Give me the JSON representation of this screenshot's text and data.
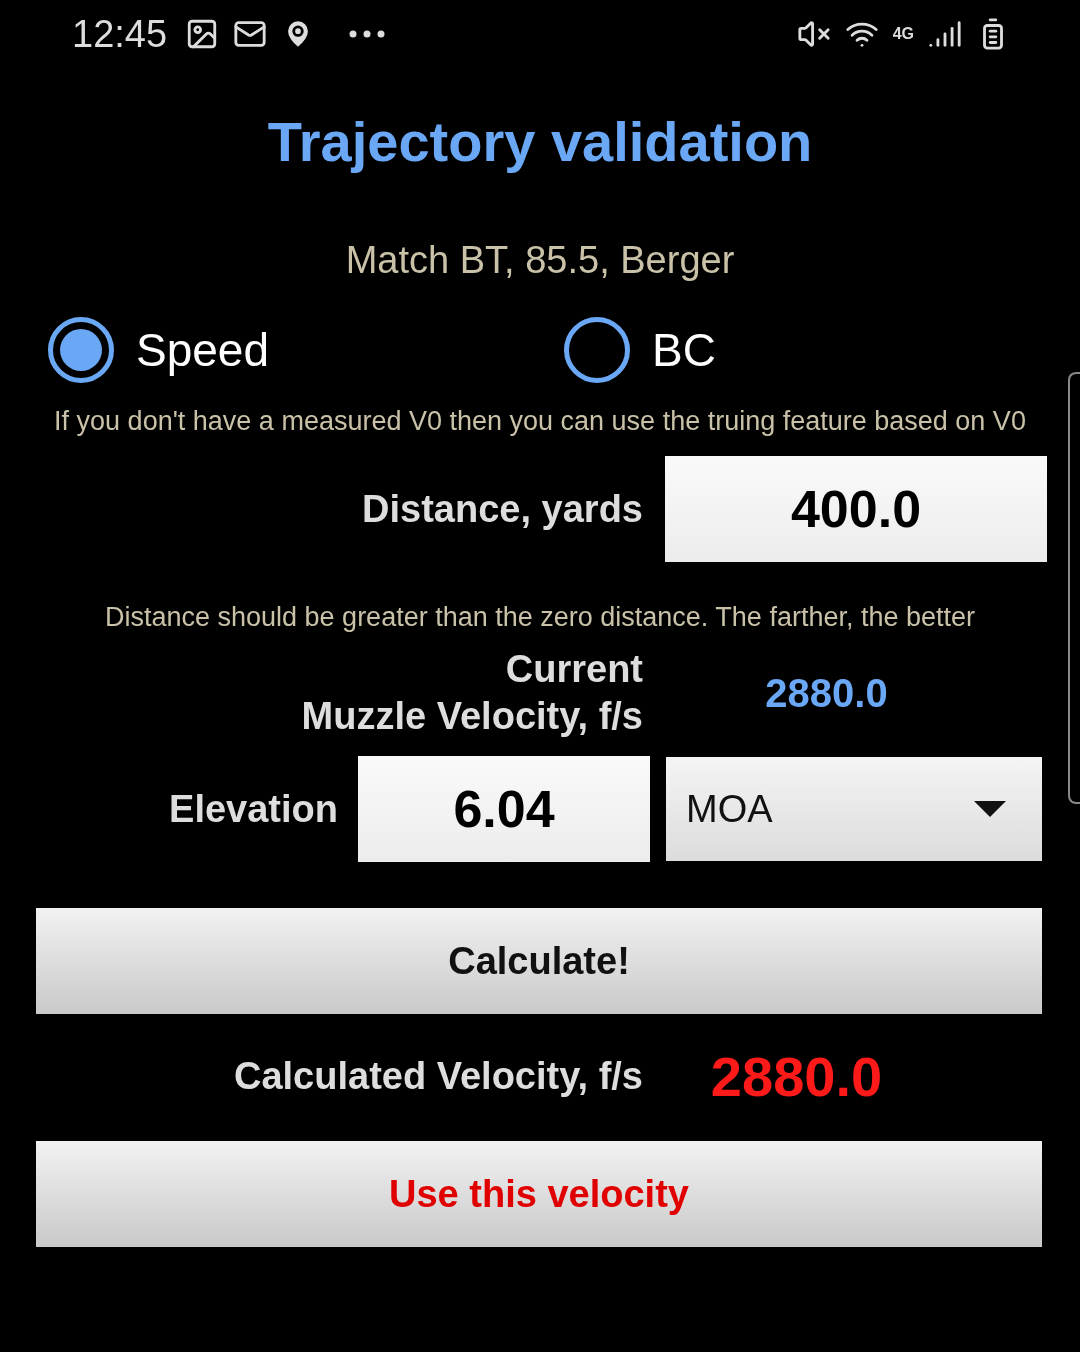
{
  "status_bar": {
    "time": "12:45",
    "network": "4G"
  },
  "title": "Trajectory validation",
  "subtitle": "Match BT, 85.5, Berger",
  "modes": [
    {
      "label": "Speed",
      "selected": true
    },
    {
      "label": "BC",
      "selected": false
    }
  ],
  "hint": "If you don't have a measured V0 then you can use the truing feature based on V0",
  "distance": {
    "label": "Distance, yards",
    "value": "400.0"
  },
  "distance_note": "Distance should be greater than the zero distance. The farther, the better",
  "current_velocity": {
    "label": "Current\nMuzzle Velocity, f/s",
    "value": "2880.0"
  },
  "elevation": {
    "label": "Elevation",
    "value": "6.04",
    "unit": "MOA"
  },
  "calculate_button": "Calculate!",
  "result": {
    "label": "Calculated Velocity, f/s",
    "value": "2880.0"
  },
  "use_button": "Use this velocity"
}
